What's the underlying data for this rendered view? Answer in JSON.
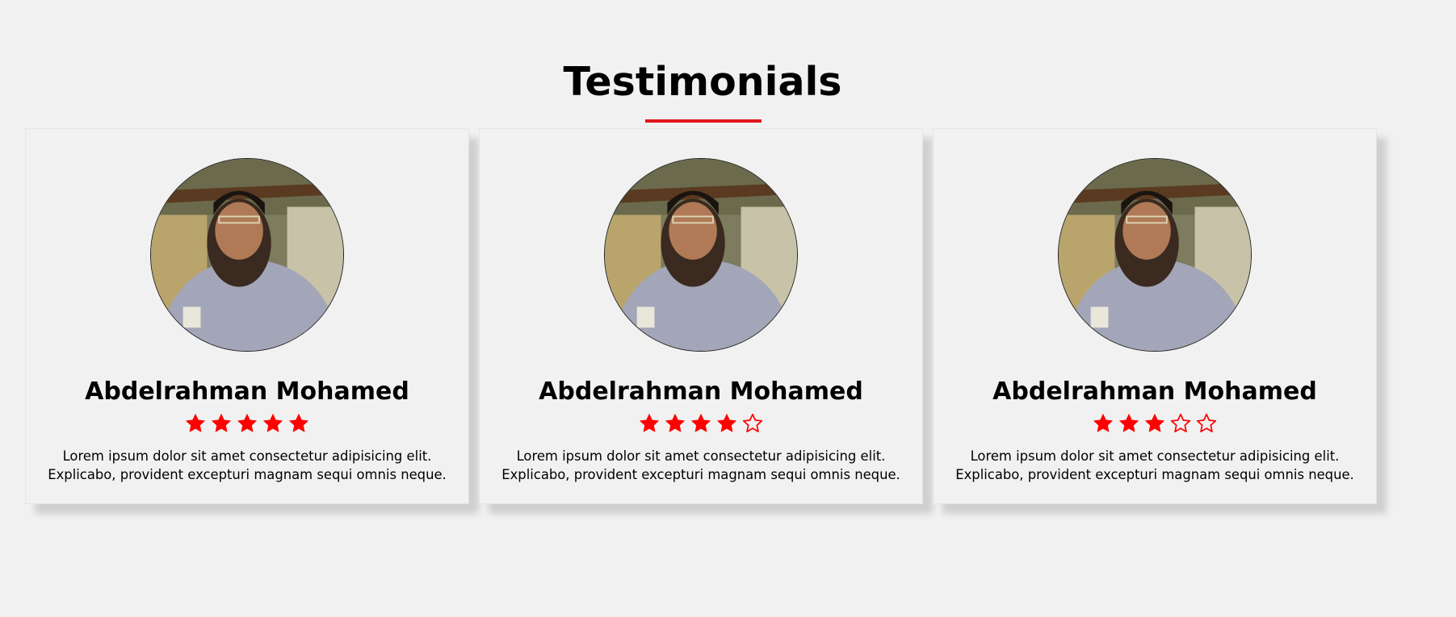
{
  "section": {
    "title": "Testimonials"
  },
  "colors": {
    "accent": "#e3141a",
    "background": "#f1f1f1",
    "star": "#ff0000"
  },
  "testimonials": [
    {
      "name": "Abdelrahman Mohamed",
      "rating": 5,
      "max_rating": 5,
      "text": "Lorem ipsum dolor sit amet consectetur adipisicing elit. Explicabo, provident excepturi magnam sequi omnis neque."
    },
    {
      "name": "Abdelrahman Mohamed",
      "rating": 4,
      "max_rating": 5,
      "text": "Lorem ipsum dolor sit amet consectetur adipisicing elit. Explicabo, provident excepturi magnam sequi omnis neque."
    },
    {
      "name": "Abdelrahman Mohamed",
      "rating": 3,
      "max_rating": 5,
      "text": "Lorem ipsum dolor sit amet consectetur adipisicing elit. Explicabo, provident excepturi magnam sequi omnis neque."
    }
  ]
}
